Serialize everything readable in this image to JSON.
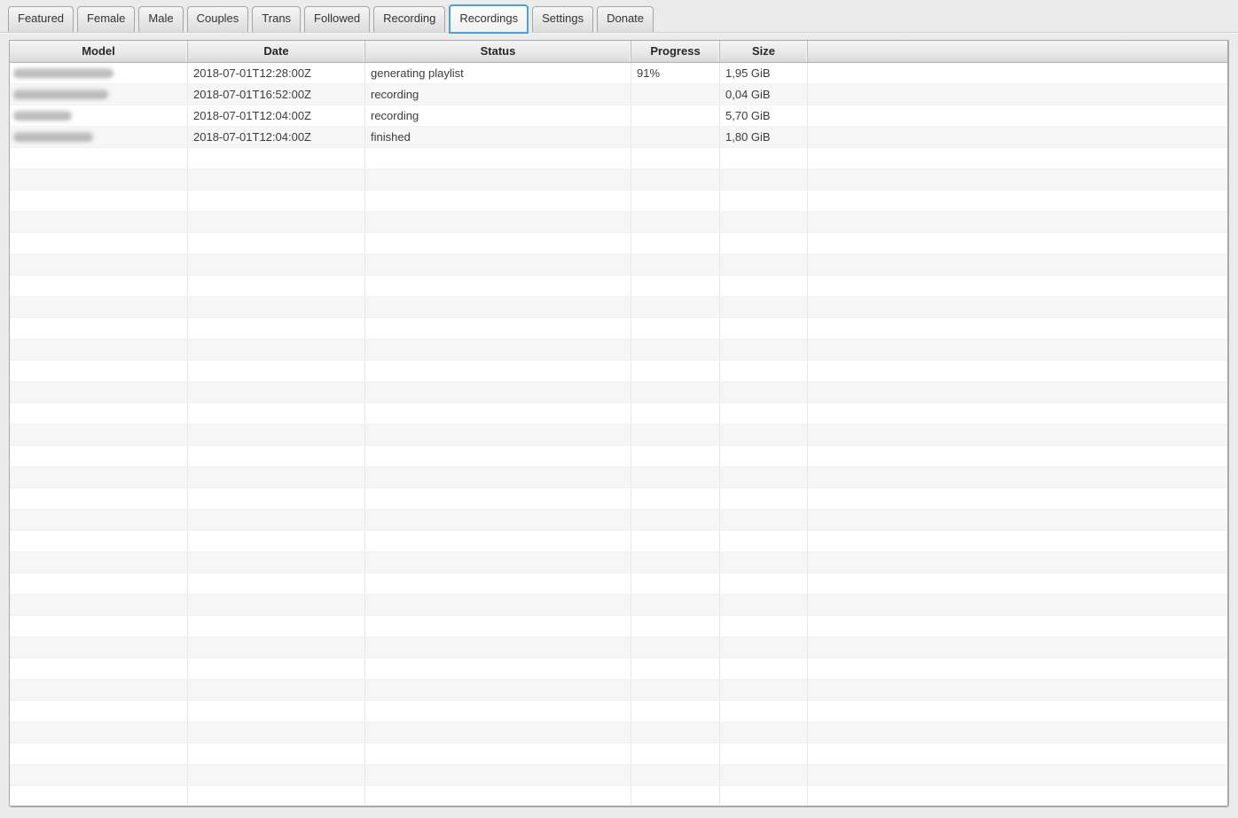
{
  "tabs": {
    "items": [
      {
        "label": "Featured",
        "selected": false
      },
      {
        "label": "Female",
        "selected": false
      },
      {
        "label": "Male",
        "selected": false
      },
      {
        "label": "Couples",
        "selected": false
      },
      {
        "label": "Trans",
        "selected": false
      },
      {
        "label": "Followed",
        "selected": false
      },
      {
        "label": "Recording",
        "selected": false
      },
      {
        "label": "Recordings",
        "selected": true
      },
      {
        "label": "Settings",
        "selected": false
      },
      {
        "label": "Donate",
        "selected": false
      }
    ]
  },
  "table": {
    "columns": [
      {
        "label": "Model"
      },
      {
        "label": "Date"
      },
      {
        "label": "Status"
      },
      {
        "label": "Progress"
      },
      {
        "label": "Size"
      },
      {
        "label": ""
      }
    ],
    "rows": [
      {
        "model_redacted": true,
        "redacted_blob_width": 113,
        "date": "2018-07-01T12:28:00Z",
        "status": "generating playlist",
        "progress": "91%",
        "size": "1,95 GiB"
      },
      {
        "model_redacted": true,
        "redacted_blob_width": 107,
        "date": "2018-07-01T16:52:00Z",
        "status": "recording",
        "progress": "",
        "size": "0,04 GiB"
      },
      {
        "model_redacted": true,
        "redacted_blob_width": 66,
        "date": "2018-07-01T12:04:00Z",
        "status": "recording",
        "progress": "",
        "size": "5,70 GiB"
      },
      {
        "model_redacted": true,
        "redacted_blob_width": 90,
        "date": "2018-07-01T12:04:00Z",
        "status": "finished",
        "progress": "",
        "size": "1,80 GiB"
      }
    ],
    "empty_row_count": 31
  },
  "colors": {
    "selected_tab_border": "#4ba1d8",
    "window_background": "#ebebeb",
    "row_stripe": "#f6f6f6",
    "header_text": "#262626",
    "table_border": "#a8a8a8"
  }
}
